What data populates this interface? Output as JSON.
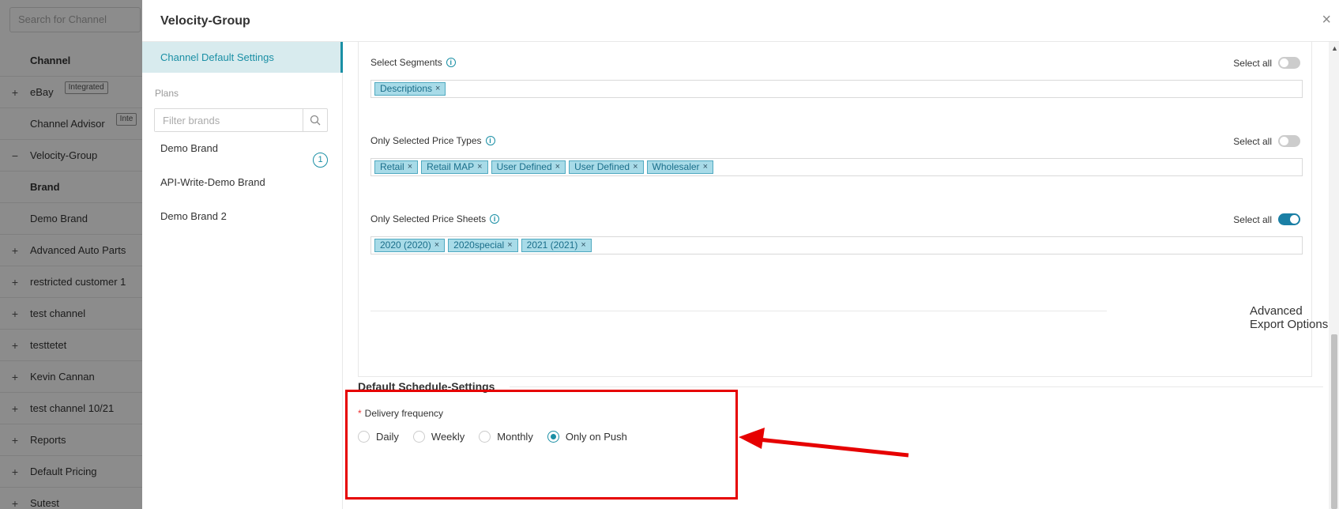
{
  "background_list": {
    "search_placeholder": "Search for Channel",
    "rows": [
      {
        "expander": "",
        "label": "Channel",
        "bold": true,
        "tag": ""
      },
      {
        "expander": "+",
        "label": "eBay",
        "bold": false,
        "tag": "Integrated"
      },
      {
        "expander": "",
        "label": "Channel Advisor",
        "bold": false,
        "tag": "Inte"
      },
      {
        "expander": "−",
        "label": "Velocity-Group",
        "bold": false,
        "tag": ""
      },
      {
        "expander": "",
        "label": "Brand",
        "bold": true,
        "tag": ""
      },
      {
        "expander": "",
        "label": "Demo Brand",
        "bold": false,
        "tag": ""
      },
      {
        "expander": "+",
        "label": "Advanced Auto Parts",
        "bold": false,
        "tag": ""
      },
      {
        "expander": "+",
        "label": "restricted customer 1",
        "bold": false,
        "tag": ""
      },
      {
        "expander": "+",
        "label": "test channel",
        "bold": false,
        "tag": ""
      },
      {
        "expander": "+",
        "label": "testtetet",
        "bold": false,
        "tag": ""
      },
      {
        "expander": "+",
        "label": "Kevin Cannan",
        "bold": false,
        "tag": ""
      },
      {
        "expander": "+",
        "label": "test channel 10/21",
        "bold": false,
        "tag": ""
      },
      {
        "expander": "+",
        "label": "Reports",
        "bold": false,
        "tag": ""
      },
      {
        "expander": "+",
        "label": "Default Pricing",
        "bold": false,
        "tag": ""
      },
      {
        "expander": "+",
        "label": "Sutest",
        "bold": false,
        "tag": ""
      }
    ]
  },
  "drawer": {
    "title": "Velocity-Group",
    "close_label": "×"
  },
  "left_nav": {
    "active_item": "Channel Default Settings",
    "plans_label": "Plans",
    "filter_placeholder": "Filter brands",
    "brands": [
      "Demo Brand",
      "API-Write-Demo Brand",
      "Demo Brand 2"
    ],
    "first_brand_badge": "1"
  },
  "segments": {
    "label": "Select Segments",
    "select_all_label": "Select all",
    "select_all_on": false,
    "chips": [
      "Descriptions"
    ]
  },
  "price_types": {
    "label": "Only Selected Price Types",
    "select_all_label": "Select all",
    "select_all_on": false,
    "chips": [
      "Retail",
      "Retail MAP",
      "User Defined",
      "User Defined",
      "Wholesaler"
    ]
  },
  "price_sheets": {
    "label": "Only Selected Price Sheets",
    "select_all_label": "Select all",
    "select_all_on": true,
    "chips": [
      "2020 (2020)",
      "2020special",
      "2021 (2021)"
    ]
  },
  "advanced_export": {
    "label": "Advanced Export Options",
    "on": false
  },
  "schedule": {
    "title": "Default Schedule-Settings",
    "required_mark": "*",
    "frequency_label": "Delivery frequency",
    "options": [
      "Daily",
      "Weekly",
      "Monthly",
      "Only on Push"
    ],
    "selected": "Only on Push"
  },
  "colors": {
    "accent": "#1a8fa5",
    "chip_bg": "#a8dbe8",
    "annotation_red": "#e60000"
  }
}
